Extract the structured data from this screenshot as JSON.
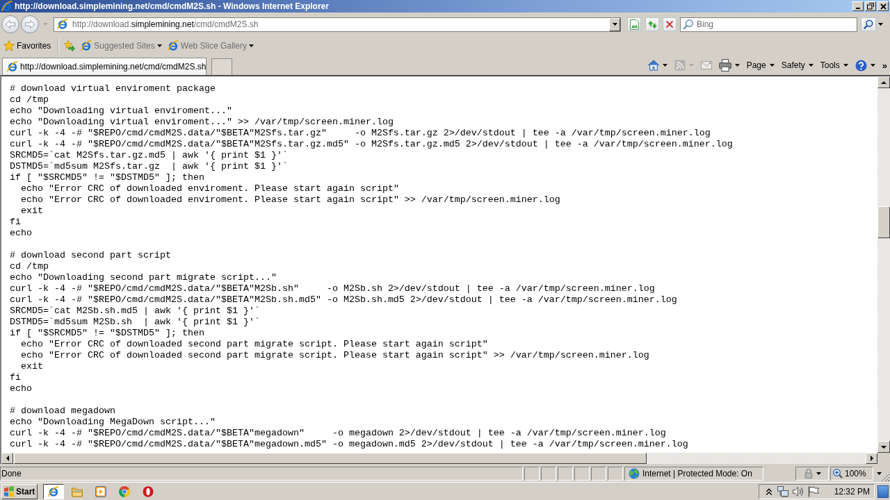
{
  "window": {
    "title": "http://download.simplemining.net/cmd/cmdM2S.sh - Windows Internet Explorer"
  },
  "address_bar": {
    "url": [
      {
        "text": "http://download.",
        "emphasis": false
      },
      {
        "text": "simplemining.net",
        "emphasis": true
      },
      {
        "text": "/cmd/cmdM2S.sh",
        "emphasis": false
      }
    ]
  },
  "search": {
    "placeholder": "Bing"
  },
  "favorites_bar": {
    "label": "Favorites",
    "links": [
      {
        "label": "Suggested Sites",
        "disabled": true
      },
      {
        "label": "Web Slice Gallery",
        "disabled": true
      }
    ]
  },
  "tabs": [
    {
      "label": "http://download.simplemining.net/cmd/cmdM2S.sh",
      "selected": true
    }
  ],
  "command_bar": {
    "tools": [
      {
        "kind": "home",
        "disabled": false,
        "dropdown": true
      },
      {
        "kind": "feeds",
        "disabled": true,
        "dropdown": true
      },
      {
        "kind": "mail",
        "disabled": true,
        "dropdown": false
      },
      {
        "kind": "print",
        "disabled": false,
        "dropdown": true
      }
    ],
    "menus": [
      "Page",
      "Safety",
      "Tools"
    ],
    "trailing_tools": [
      {
        "kind": "help",
        "disabled": false,
        "dropdown": true
      }
    ],
    "overflow": "»"
  },
  "code_blocks": [
    {
      "lines": [
        {
          "text": "# download virtual enviroment package"
        },
        {
          "text": "cd /tmp"
        },
        {
          "text": "echo \"Downloading virtual enviroment...\""
        },
        {
          "text": "echo \"Downloading virtual enviroment...\" >> /var/tmp/screen.miner.log"
        },
        {
          "text": "curl -k -4 -# \"$REPO/cmd/cmdM2S.data/\"$BETA\"M2Sfs.tar.gz\"     -o M2Sfs.tar.gz 2>/dev/stdout | tee -a /var/tmp/screen.miner.log"
        },
        {
          "text": "curl -k -4 -# \"$REPO/cmd/cmdM2S.data/\"$BETA\"M2Sfs.tar.gz.md5\" -o M2Sfs.tar.gz.md5 2>/dev/stdout | tee -a /var/tmp/screen.miner.log"
        },
        {
          "text": "SRCMD5=`cat M2Sfs.tar.gz.md5 | awk '{ print $1 }'`"
        },
        {
          "text": "DSTMD5=`md5sum M2Sfs.tar.gz  | awk '{ print $1 }'`"
        },
        {
          "text": "if [ \"$SRCMD5\" != \"$DSTMD5\" ]; then",
          "children": [
            {
              "text": "echo \"Error CRC of downloaded enviroment. Please start again script\""
            },
            {
              "text": "echo \"Error CRC of downloaded enviroment. Please start again script\" >> /var/tmp/screen.miner.log"
            },
            {
              "text": "exit"
            }
          ]
        },
        {
          "text": "fi"
        },
        {
          "text": "echo"
        }
      ]
    },
    {
      "lines": [
        {
          "text": "# download second part script"
        },
        {
          "text": "cd /tmp"
        },
        {
          "text": "echo \"Downloading second part migrate script...\""
        },
        {
          "text": "curl -k -4 -# \"$REPO/cmd/cmdM2S.data/\"$BETA\"M2Sb.sh\"     -o M2Sb.sh 2>/dev/stdout | tee -a /var/tmp/screen.miner.log"
        },
        {
          "text": "curl -k -4 -# \"$REPO/cmd/cmdM2S.data/\"$BETA\"M2Sb.sh.md5\" -o M2Sb.sh.md5 2>/dev/stdout | tee -a /var/tmp/screen.miner.log"
        },
        {
          "text": "SRCMD5=`cat M2Sb.sh.md5 | awk '{ print $1 }'`"
        },
        {
          "text": "DSTMD5=`md5sum M2Sb.sh  | awk '{ print $1 }'`"
        },
        {
          "text": "if [ \"$SRCMD5\" != \"$DSTMD5\" ]; then",
          "children": [
            {
              "text": "echo \"Error CRC of downloaded second part migrate script. Please start again script\""
            },
            {
              "text": "echo \"Error CRC of downloaded second part migrate script. Please start again script\" >> /var/tmp/screen.miner.log"
            },
            {
              "text": "exit"
            }
          ]
        },
        {
          "text": "fi"
        },
        {
          "text": "echo"
        }
      ]
    },
    {
      "lines": [
        {
          "text": "# download megadown"
        },
        {
          "text": "echo \"Downloading MegaDown script...\""
        },
        {
          "text": "curl -k -4 -# \"$REPO/cmd/cmdM2S.data/\"$BETA\"megadown\"     -o megadown 2>/dev/stdout | tee -a /var/tmp/screen.miner.log"
        },
        {
          "text": "curl -k -4 -# \"$REPO/cmd/cmdM2S.data/\"$BETA\"megadown.md5\" -o megadown.md5 2>/dev/stdout | tee -a /var/tmp/screen.miner.log"
        }
      ]
    }
  ],
  "status_bar": {
    "text": "Done",
    "zone": "Internet | Protected Mode: On",
    "zoom": "100%"
  },
  "taskbar": {
    "start": "Start",
    "apps": [
      {
        "kind": "ie",
        "selected": true
      },
      {
        "kind": "explorer",
        "selected": false
      },
      {
        "kind": "media",
        "selected": false
      },
      {
        "kind": "chrome",
        "selected": false
      },
      {
        "kind": "opera",
        "selected": false
      }
    ],
    "clock": "12:32 PM"
  }
}
